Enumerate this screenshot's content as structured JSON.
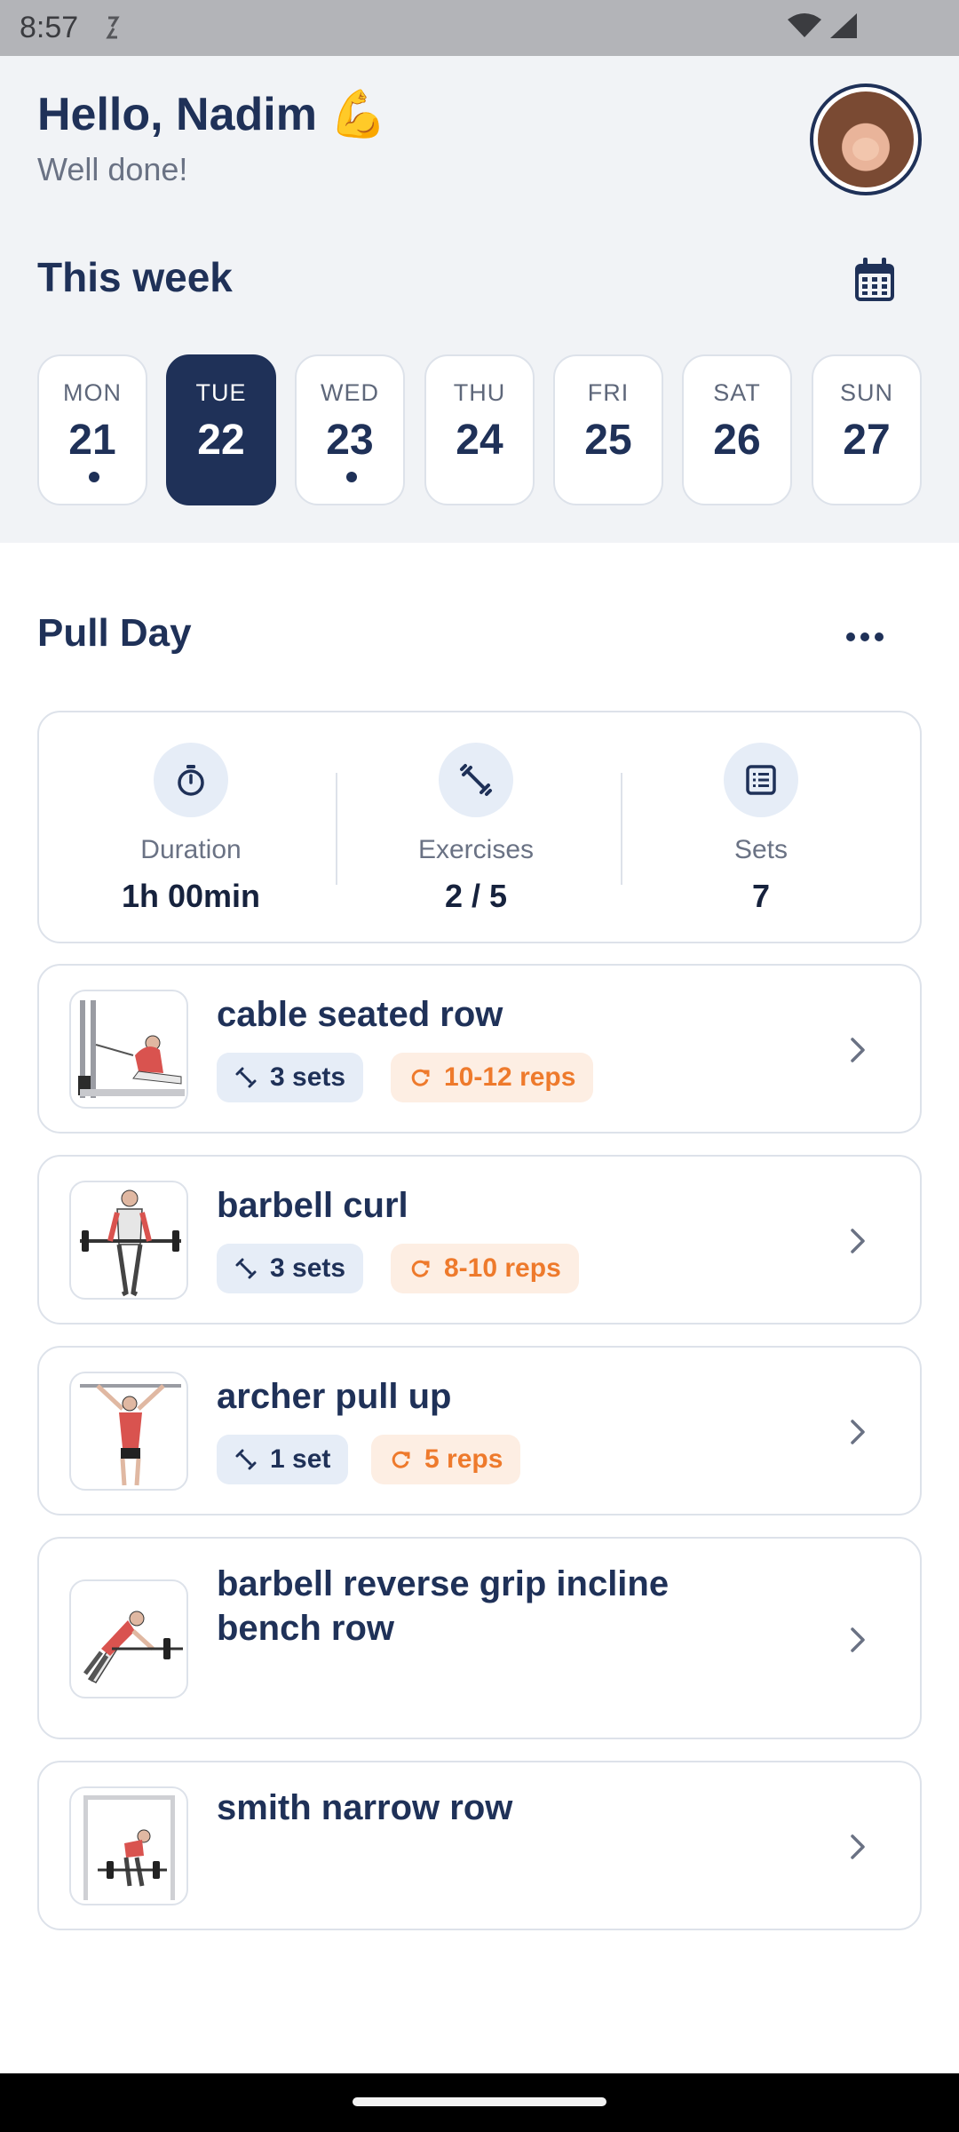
{
  "status_bar": {
    "time": "8:57"
  },
  "header": {
    "greeting": "Hello, Nadim 💪",
    "subtitle": "Well done!",
    "week_title": "This week"
  },
  "days": [
    {
      "name": "MON",
      "num": "21",
      "has_dot": true,
      "selected": false
    },
    {
      "name": "TUE",
      "num": "22",
      "has_dot": false,
      "selected": true
    },
    {
      "name": "WED",
      "num": "23",
      "has_dot": true,
      "selected": false
    },
    {
      "name": "THU",
      "num": "24",
      "has_dot": false,
      "selected": false
    },
    {
      "name": "FRI",
      "num": "25",
      "has_dot": false,
      "selected": false
    },
    {
      "name": "SAT",
      "num": "26",
      "has_dot": false,
      "selected": false
    },
    {
      "name": "SUN",
      "num": "27",
      "has_dot": false,
      "selected": false
    }
  ],
  "workout": {
    "title": "Pull Day",
    "stats": [
      {
        "icon": "stopwatch-icon",
        "label": "Duration",
        "value": "1h 00min"
      },
      {
        "icon": "dumbbell-icon",
        "label": "Exercises",
        "value": "2 / 5"
      },
      {
        "icon": "list-icon",
        "label": "Sets",
        "value": "7"
      }
    ]
  },
  "exercises": [
    {
      "name": "cable seated row",
      "sets": "3 sets",
      "reps": "10-12 reps"
    },
    {
      "name": "barbell curl",
      "sets": "3 sets",
      "reps": "8-10 reps"
    },
    {
      "name": "archer pull up",
      "sets": "1 set",
      "reps": "5 reps"
    },
    {
      "name": "barbell reverse grip incline bench row",
      "sets": "",
      "reps": ""
    },
    {
      "name": "smith narrow row",
      "sets": "",
      "reps": ""
    }
  ],
  "colors": {
    "primary": "#1f3158",
    "accent_orange": "#ee7a2c",
    "chip_blue_bg": "#e6edf7",
    "chip_orange_bg": "#fdeee3",
    "header_bg": "#f1f3f6"
  }
}
